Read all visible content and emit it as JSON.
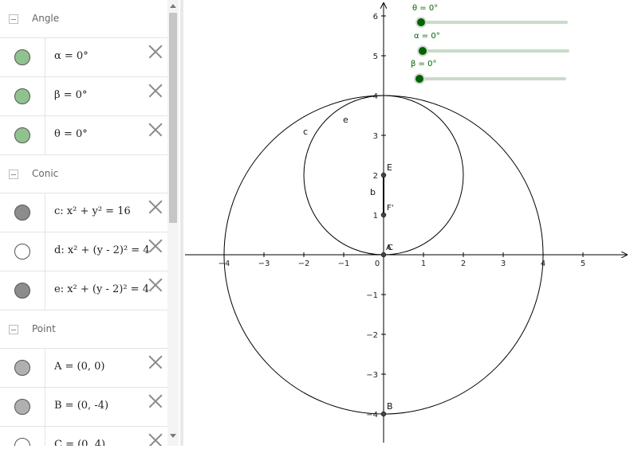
{
  "algebra": {
    "groups": [
      {
        "title": "Angle",
        "items": [
          {
            "expr": "α = 0°",
            "marble": "#8fc28f"
          },
          {
            "expr": "β = 0°",
            "marble": "#8fc28f"
          },
          {
            "expr": "θ = 0°",
            "marble": "#8fc28f"
          }
        ]
      },
      {
        "title": "Conic",
        "items": [
          {
            "expr": "c: x² + y² = 16",
            "marble": "#8c8c8c"
          },
          {
            "expr": "d: x² + (y - 2)² = 4",
            "marble": "#ffffff"
          },
          {
            "expr": "e: x² + (y - 2)² = 4",
            "marble": "#8c8c8c"
          }
        ]
      },
      {
        "title": "Point",
        "items": [
          {
            "expr": "A = (0, 0)",
            "marble": "#b0b0b0"
          },
          {
            "expr": "B = (0, -4)",
            "marble": "#b0b0b0"
          },
          {
            "expr": "C = (0, 4)",
            "marble": "#ffffff"
          }
        ]
      }
    ]
  },
  "sliders": [
    {
      "label": "θ = 0°",
      "value": 0
    },
    {
      "label": "α = 0°",
      "value": 0
    },
    {
      "label": "β = 0°",
      "value": 0
    }
  ],
  "axes": {
    "x_ticks": [
      "−4",
      "−3",
      "−2",
      "−1",
      "0",
      "1",
      "2",
      "3",
      "4",
      "5"
    ],
    "y_ticks": [
      "6",
      "5",
      "4",
      "3",
      "2",
      "1",
      "−1",
      "−2",
      "−3",
      "−4"
    ]
  },
  "object_labels": {
    "c": "c",
    "e": "e",
    "b": "b",
    "E": "E",
    "F": "F'",
    "A": "A",
    "C": "C",
    "B": "B"
  },
  "colors": {
    "slider_green": "#006400",
    "slider_track": "#c8dcc8",
    "curve": "#000000"
  }
}
